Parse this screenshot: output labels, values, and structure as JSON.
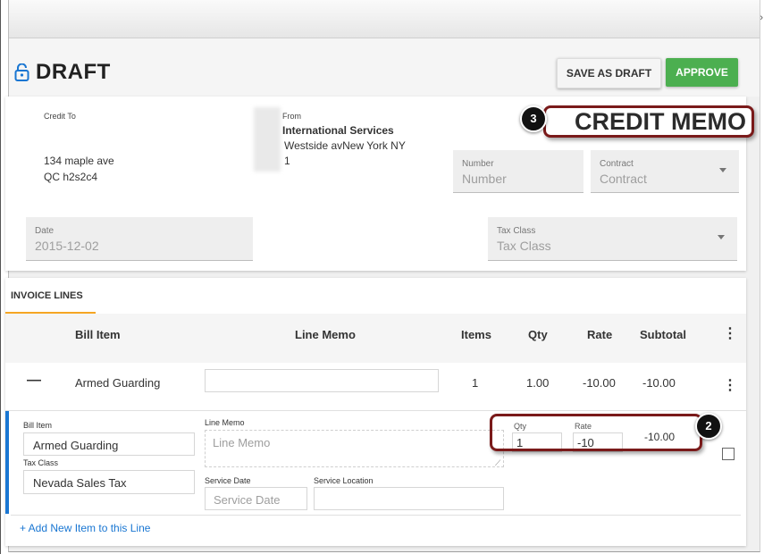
{
  "topbar": {
    "chevron_icon": "chevron-right-icon"
  },
  "header": {
    "status_title": "DRAFT",
    "lock_icon": "unlock-icon",
    "save_draft_label": "SAVE AS DRAFT",
    "approve_label": "APPROVE"
  },
  "bill": {
    "credit_to_label": "Credit To",
    "credit_to_line1": "134 maple ave",
    "credit_to_line2": "QC h2s2c4",
    "from_label": "From",
    "from_name": "International Services",
    "from_line1": "Westside avNew York NY",
    "from_line2": "1",
    "number_label": "Number",
    "number_placeholder": "Number",
    "contract_label": "Contract",
    "contract_placeholder": "Contract",
    "date_label": "Date",
    "date_value": "2015-12-02",
    "tax_class_label": "Tax Class",
    "tax_class_placeholder": "Tax Class"
  },
  "callouts": {
    "credit_memo_text": "CREDIT MEMO",
    "badge_3": "3",
    "badge_2": "2"
  },
  "invoice": {
    "tab_label": "INVOICE LINES",
    "columns": {
      "bill_item": "Bill Item",
      "line_memo": "Line Memo",
      "items": "Items",
      "qty": "Qty",
      "rate": "Rate",
      "subtotal": "Subtotal"
    },
    "row": {
      "collapse_symbol": "—",
      "bill_item": "Armed Guarding",
      "line_memo": "",
      "items": "1",
      "qty": "1.00",
      "rate": "-10.00",
      "subtotal": "-10.00"
    },
    "detail": {
      "bill_item_label": "Bill Item",
      "bill_item_value": "Armed Guarding",
      "tax_class_label": "Tax Class",
      "tax_class_value": "Nevada Sales Tax",
      "line_memo_label": "Line Memo",
      "line_memo_placeholder": "Line Memo",
      "service_date_label": "Service Date",
      "service_date_placeholder": "Service Date",
      "service_location_label": "Service Location",
      "service_location_value": "",
      "qty_label": "Qty",
      "qty_value": "1",
      "rate_label": "Rate",
      "rate_value": "-10",
      "subtotal_value": "-10.00"
    },
    "add_item_label": "+ Add New Item to this Line"
  },
  "colors": {
    "approve": "#4caf50",
    "accent_tab": "#f5a623",
    "link": "#1976d2",
    "callout_border": "#7a1a1a"
  }
}
